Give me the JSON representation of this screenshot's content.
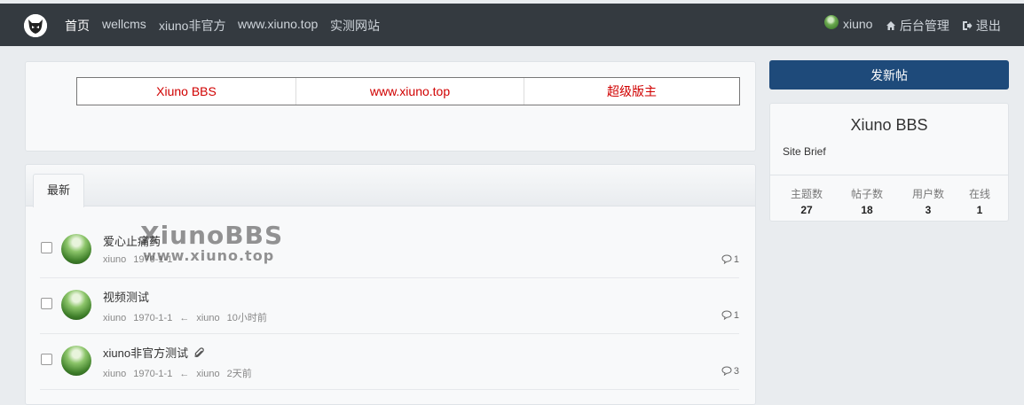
{
  "nav": {
    "items": [
      {
        "label": "首页",
        "active": true
      },
      {
        "label": "wellcms"
      },
      {
        "label": "xiuno非官方"
      },
      {
        "label": "www.xiuno.top"
      },
      {
        "label": "实测网站"
      }
    ],
    "user": "xiuno",
    "admin": "后台管理",
    "logout": "退出"
  },
  "links": [
    "Xiuno BBS",
    "www.xiuno.top",
    "超级版主"
  ],
  "tab": "最新",
  "threads": [
    {
      "title": "爱心止痛药",
      "author": "xiuno",
      "date": "1970-1-1",
      "last_author": "",
      "last_time": "",
      "replies": "1",
      "attachment": false
    },
    {
      "title": "视频测试",
      "author": "xiuno",
      "date": "1970-1-1",
      "last_author": "xiuno",
      "last_time": "10小时前",
      "replies": "1",
      "attachment": false
    },
    {
      "title": "xiuno非官方测试",
      "author": "xiuno",
      "date": "1970-1-1",
      "last_author": "xiuno",
      "last_time": "2天前",
      "replies": "3",
      "attachment": true
    }
  ],
  "watermark": {
    "line1": "XiunoBBS",
    "line2": "www.xiuno.top"
  },
  "sidebar": {
    "post_button": "发新帖",
    "site_name": "Xiuno BBS",
    "site_brief": "Site Brief",
    "stats": [
      {
        "label": "主题数",
        "value": "27"
      },
      {
        "label": "帖子数",
        "value": "18"
      },
      {
        "label": "用户数",
        "value": "3"
      },
      {
        "label": "在线",
        "value": "1"
      }
    ]
  },
  "colors": {
    "topbar": "#343a40",
    "link_red": "#d00000",
    "post_button": "#1e4a7a"
  }
}
